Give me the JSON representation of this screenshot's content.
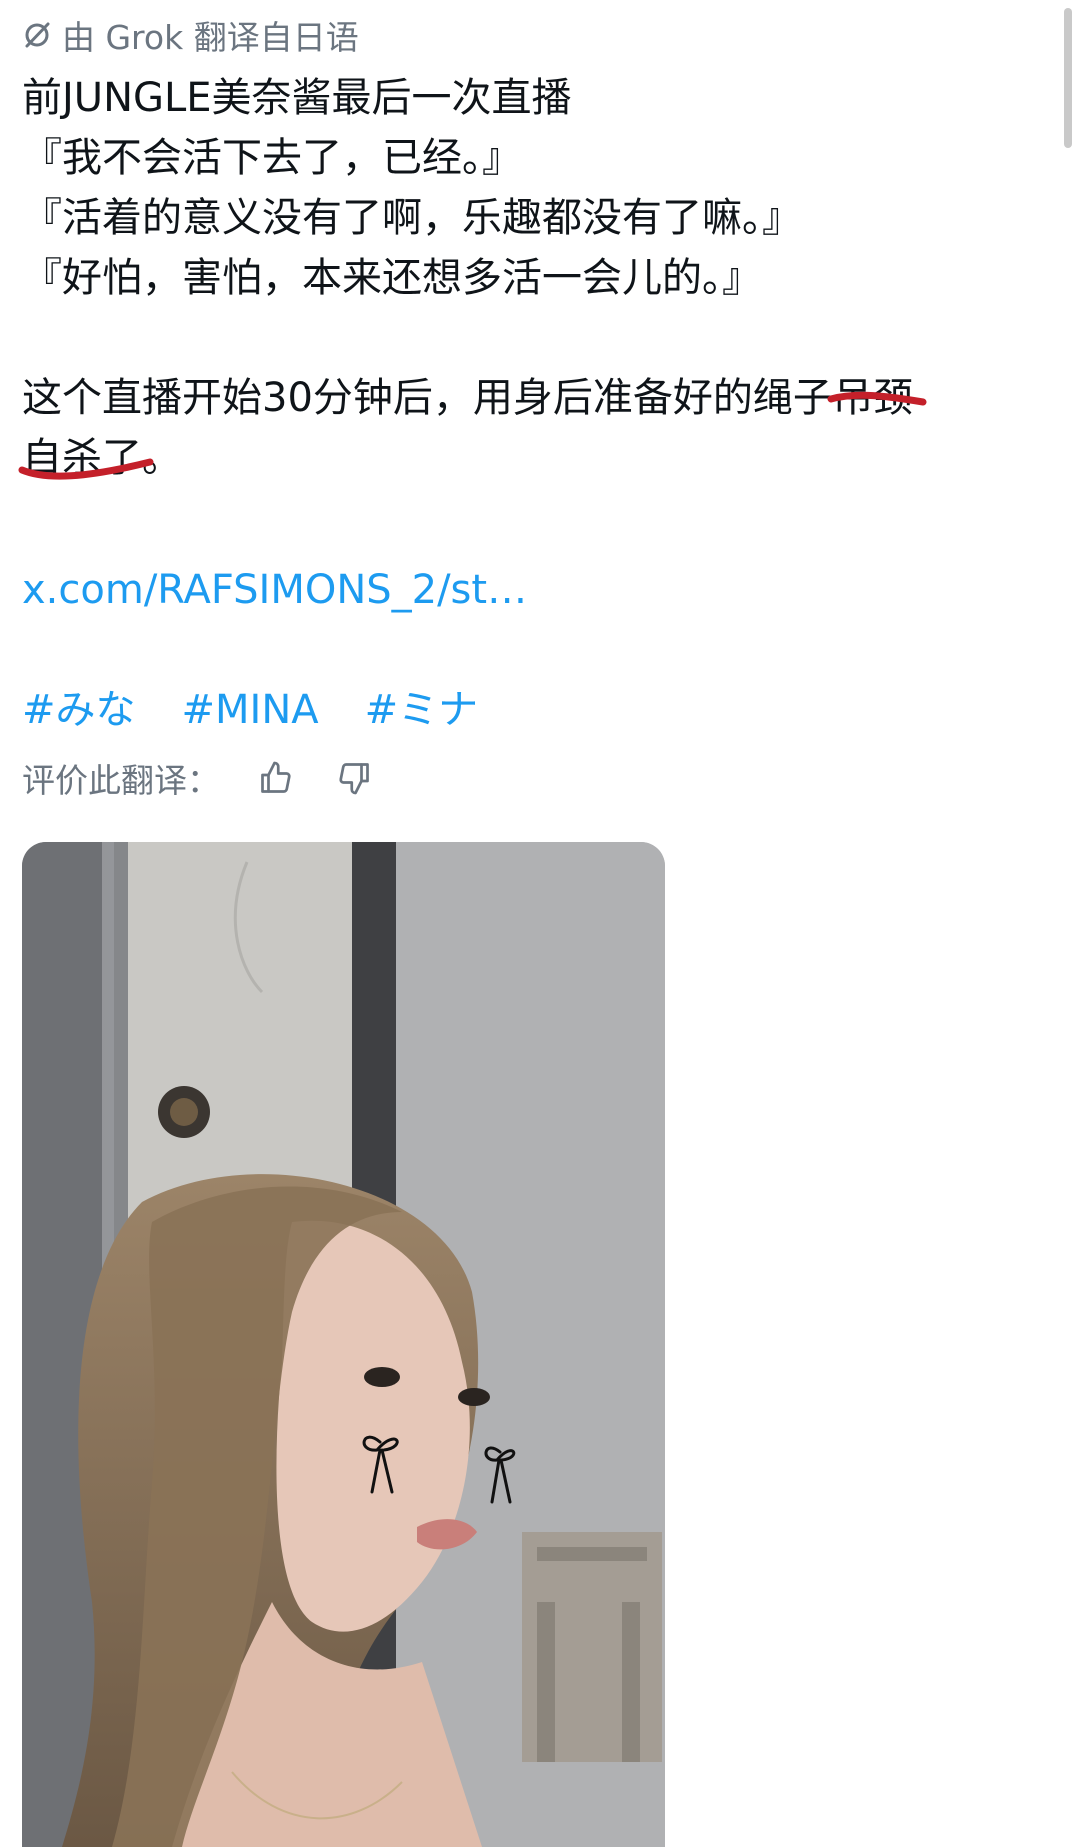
{
  "translation_notice": {
    "icon": "grok-slash-icon",
    "text": "由 Grok 翻译自日语"
  },
  "post": {
    "lines": [
      "前JUNGLE美奈酱最后一次直播",
      "『我不会活下去了，已经。』",
      "『活着的意义没有了啊，乐趣都没有了嘛。』",
      "『好怕，害怕，本来还想多活一会儿的。』"
    ],
    "sentence_part1": "这个直播开始30分钟后，用身后准备好的绳子",
    "struck_word_1": "吊颈",
    "struck_word_2": "自杀了",
    "sentence_end": "。",
    "strike_color": "#c4202a"
  },
  "link": {
    "text": "x.com/RAFSIMONS_2/st…"
  },
  "hashtags": [
    "#みな",
    "#MINA",
    "#ミナ"
  ],
  "rate": {
    "label": "评价此翻译：",
    "thumbs_up_icon": "thumbs-up-icon",
    "thumbs_down_icon": "thumbs-down-icon"
  },
  "colors": {
    "link": "#1d9bf0",
    "secondary_text": "#6b7580",
    "text": "#0f1419"
  }
}
